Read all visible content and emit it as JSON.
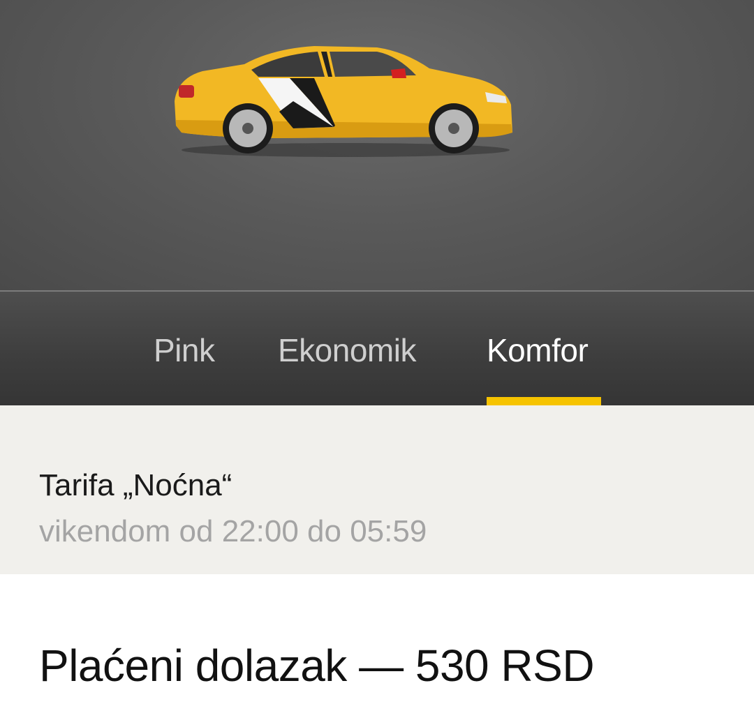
{
  "hero": {
    "image": "yellow-taxi-sedan"
  },
  "tabs": [
    {
      "label": "Pink",
      "active": false
    },
    {
      "label": "Ekonomik",
      "active": false
    },
    {
      "label": "Komfor",
      "active": true
    }
  ],
  "tariff": {
    "title": "Tarifa „Noćna“",
    "subtitle": "vikendom od 22:00 do 05:59"
  },
  "content": {
    "paid_arrival": "Plaćeni dolazak — 530 RSD"
  },
  "colors": {
    "accent": "#f6c300",
    "tab_active": "#ffffff",
    "tab_inactive": "#cfcfcf",
    "tariff_bg": "#f1f0ec",
    "muted_text": "#a4a4a4"
  }
}
